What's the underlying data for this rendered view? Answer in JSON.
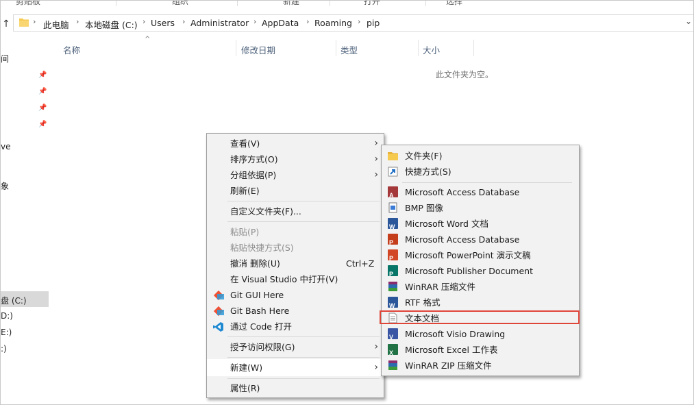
{
  "ribbon": {
    "groups": [
      "剪贴板",
      "组织",
      "新建",
      "打开",
      "选择"
    ]
  },
  "address": {
    "crumbs": [
      "此电脑",
      "本地磁盘 (C:)",
      "Users",
      "Administrator",
      "AppData",
      "Roaming",
      "pip"
    ]
  },
  "columns": {
    "name": "名称",
    "modified": "修改日期",
    "type": "类型",
    "size": "大小"
  },
  "empty_message": "此文件夹为空。",
  "nav": {
    "fragments": [
      "间",
      "ve",
      "象",
      "盘 (C:)",
      "D:)",
      "E:)",
      ":)"
    ]
  },
  "context_menu": {
    "view": "查看(V)",
    "sort": "排序方式(O)",
    "group": "分组依据(P)",
    "refresh": "刷新(E)",
    "customize": "自定义文件夹(F)...",
    "paste": "粘贴(P)",
    "paste_shortcut": "粘贴快捷方式(S)",
    "undo_delete": "撤消 删除(U)",
    "undo_shortcut": "Ctrl+Z",
    "open_vs": "在 Visual Studio 中打开(V)",
    "git_gui": "Git GUI Here",
    "git_bash": "Git Bash Here",
    "open_code": "通过 Code 打开",
    "grant_access": "授予访问权限(G)",
    "new": "新建(W)",
    "properties": "属性(R)"
  },
  "new_submenu": {
    "folder": "文件夹(F)",
    "shortcut": "快捷方式(S)",
    "access_db": "Microsoft Access Database",
    "bmp": "BMP 图像",
    "word": "Microsoft Word 文档",
    "access_db2": "Microsoft Access Database",
    "ppt": "Microsoft PowerPoint 演示文稿",
    "publisher": "Microsoft Publisher Document",
    "winrar": "WinRAR 压缩文件",
    "rtf": "RTF 格式",
    "text": "文本文档",
    "visio": "Microsoft Visio Drawing",
    "excel": "Microsoft Excel 工作表",
    "winrar_zip": "WinRAR ZIP 压缩文件"
  },
  "icon_colors": {
    "folder": "#f6c94f",
    "access": "#a4373a",
    "word": "#2b579a",
    "ppt": "#d24726",
    "publisher": "#077568",
    "excel": "#217346",
    "visio": "#3955a3",
    "winrar": "#8b2c6d",
    "vscode": "#1f8ad2",
    "git": "#f05033",
    "highlight": "#e0453a"
  }
}
